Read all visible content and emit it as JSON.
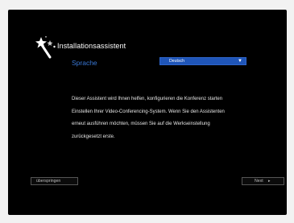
{
  "wizard": {
    "title": "Installationsassistent",
    "icon": "magic-wand-icon"
  },
  "language": {
    "label": "Sprache",
    "selected": "Deutsch",
    "caret_icon": "dropdown-arrow-icon"
  },
  "description": {
    "lines": [
      "Dieser Assistent wird Ihnen helfen, konfigurieren die Konferenz starten",
      "Einstellen Ihrer Video-Conferencing-System. Wenn Sie den Assistenten",
      "erneut ausführen möchten, müssen Sie auf die Werkseinstellung",
      "zurückgesetzt erste."
    ]
  },
  "footer": {
    "skip_label": "überspringen",
    "next_label": "Next",
    "next_icon": "arrow-right-icon"
  },
  "colors": {
    "screen_background": "#000000",
    "page_background": "#f2f2f2",
    "accent_label": "#3a78d6",
    "select_background": "#1f55b8"
  }
}
